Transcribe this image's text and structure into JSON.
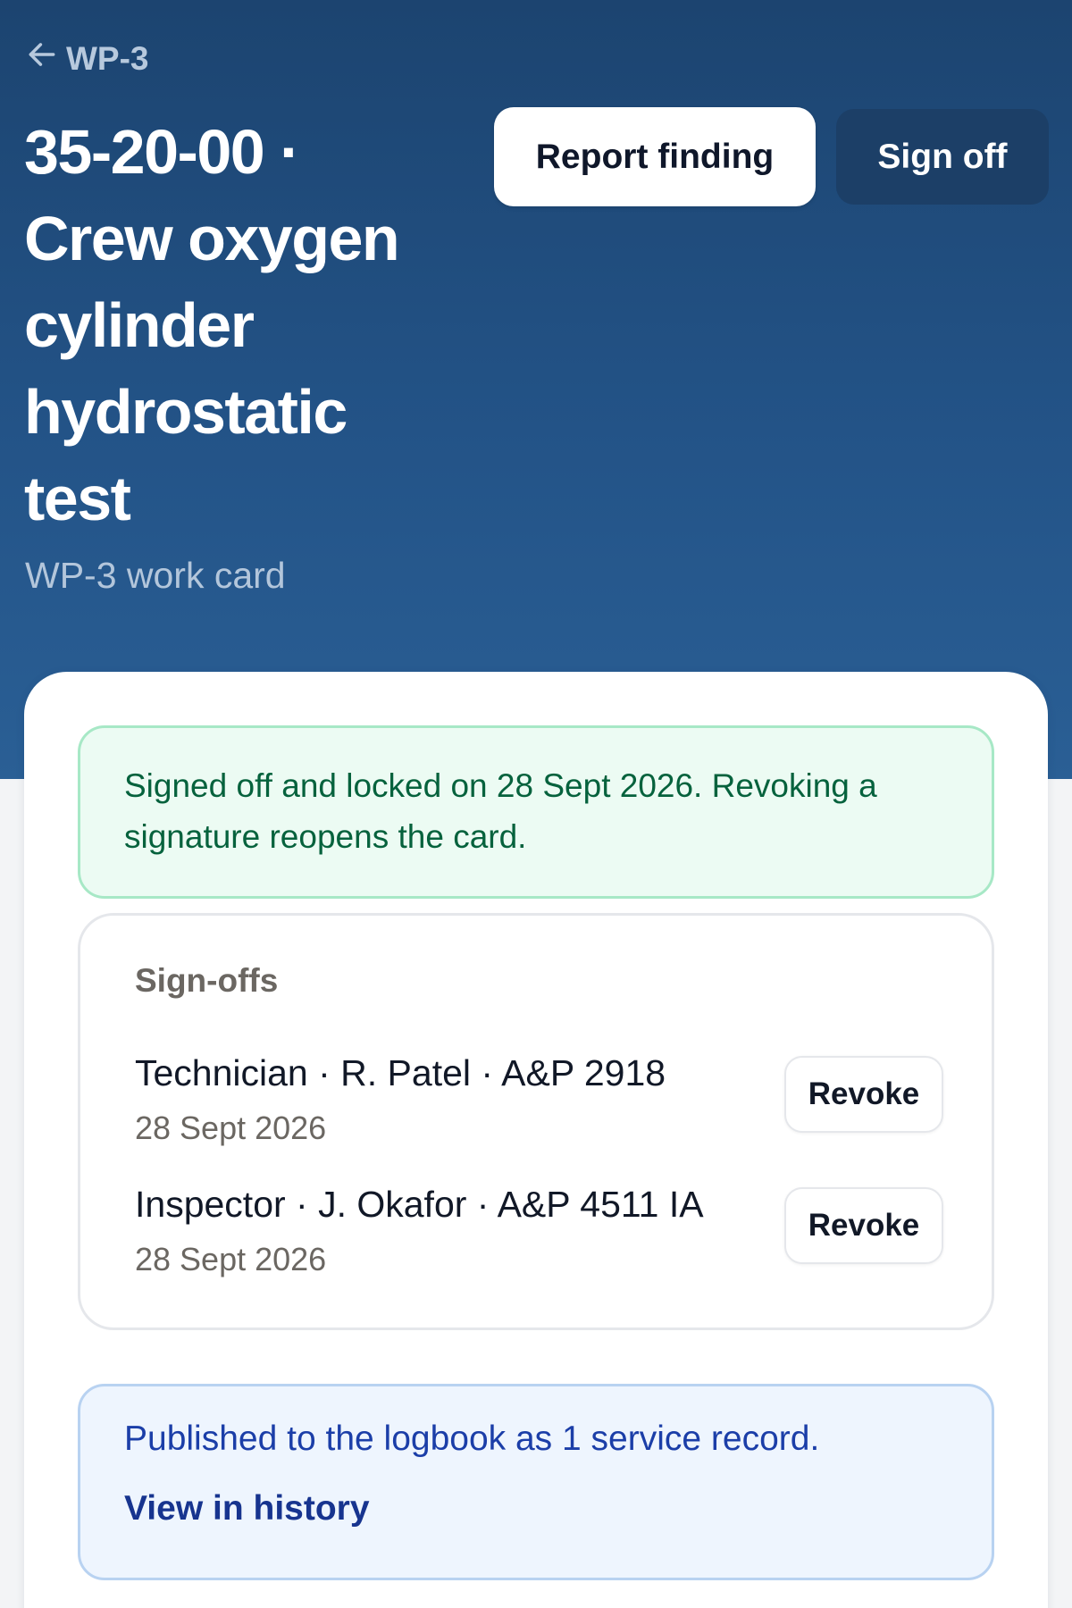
{
  "header": {
    "back_label": "WP-3",
    "title": "35-20-00 · Crew oxygen cylinder hydrostatic test",
    "subtitle": "WP-3 work card",
    "report_finding_label": "Report finding",
    "sign_off_label": "Sign off"
  },
  "card": {
    "locked_notice": "Signed off and locked on 28 Sept 2026. Revoking a signature reopens the card.",
    "signoffs": {
      "heading": "Sign-offs",
      "items": [
        {
          "role_line": "Technician · R. Patel · A&P 2918",
          "date": "28 Sept 2026",
          "action_label": "Revoke"
        },
        {
          "role_line": "Inspector · J. Okafor · A&P 4511 IA",
          "date": "28 Sept 2026",
          "action_label": "Revoke"
        }
      ]
    },
    "publish_notice": {
      "text": "Published to the logbook as 1 service record.",
      "link_label": "View in history"
    }
  },
  "colors": {
    "header_gradient_top": "#1c4470",
    "header_gradient_bottom": "#2a5f95",
    "success_bg": "#ecfbf3",
    "success_text": "#06623d",
    "info_bg": "#eef5fe",
    "info_text": "#1b3ea8"
  },
  "icons": {
    "back": "arrow-left-icon"
  }
}
